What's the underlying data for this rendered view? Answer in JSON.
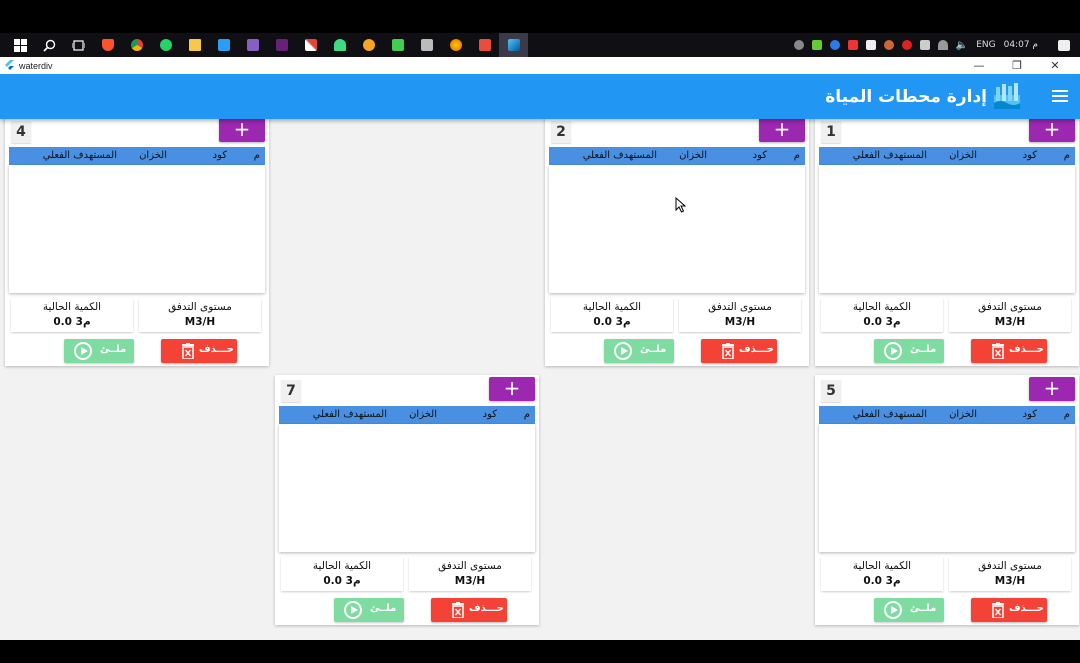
{
  "taskbar": {
    "icons": [
      "windows-start-icon",
      "search-icon",
      "task-view-icon",
      "brave-icon",
      "chrome-icon",
      "whatsapp-icon",
      "file-explorer-icon",
      "vscode-icon",
      "visual-studio-icon",
      "visual-studio-2-icon",
      "snipping-icon",
      "android-studio-icon",
      "app-icon",
      "qt-creator-icon",
      "storage-icon",
      "firefox-icon",
      "codeblocks-icon",
      "flutter-icon"
    ],
    "language": "ENG",
    "time": "04:07 م"
  },
  "window": {
    "title": "waterdiv",
    "minimize": "—",
    "restore": "❐",
    "close": "✕"
  },
  "appbar": {
    "title": "إدارة محطات المياة"
  },
  "card_labels": {
    "col_index": "م",
    "col_code": "كود",
    "col_tank": "الخزان",
    "col_target": "المستهدف الفعلي",
    "flow_label": "مستوى التدفق",
    "flow_value": "M3/H",
    "qty_label": "الكمية الحالية",
    "qty_value": "0.0 م3",
    "delete_label": "حـــذف",
    "run_label": "ملــئ",
    "add_label": "+"
  },
  "cards": [
    {
      "number": "1"
    },
    {
      "number": "2"
    },
    {
      "number": "4"
    },
    {
      "number": "5"
    },
    {
      "number": "7"
    }
  ],
  "colors": {
    "appbar": "#2196f3",
    "table_header": "#4a90e2",
    "add_button": "#9c27b0",
    "delete_button": "#f44336",
    "run_button": "#7fdca0"
  }
}
